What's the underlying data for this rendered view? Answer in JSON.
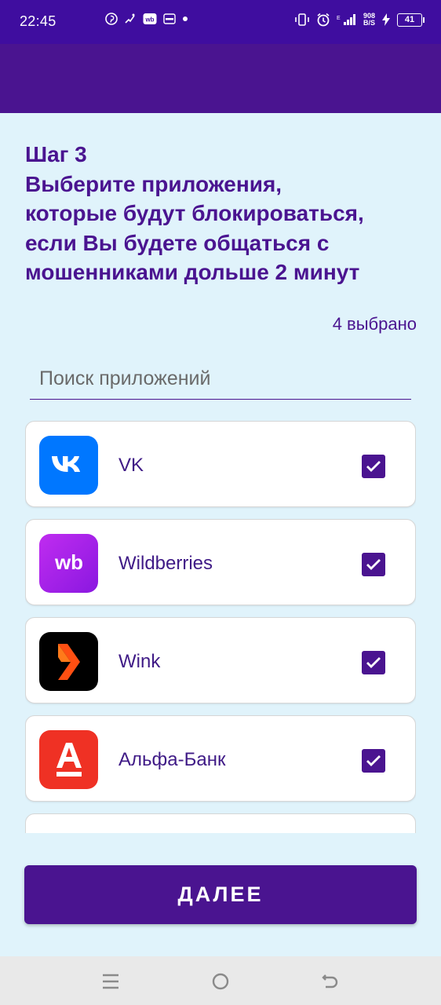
{
  "status_bar": {
    "time": "22:45",
    "net_speed_value": "908",
    "net_speed_unit": "B/S",
    "battery": "41"
  },
  "step": {
    "title_line1": "Шаг 3",
    "title_line2": "Выберите приложения,",
    "title_line3": "которые будут блокироваться,",
    "title_line4": "если Вы будете общаться с",
    "title_line5": "мошенниками дольше 2 минут"
  },
  "selected_count": "4 выбрано",
  "search": {
    "placeholder": "Поиск приложений",
    "value": ""
  },
  "apps": [
    {
      "name": "VK",
      "icon": "vk-icon",
      "checked": true,
      "color": "#0077ff"
    },
    {
      "name": "Wildberries",
      "icon": "wildberries-icon",
      "checked": true,
      "color": "#b01ee8"
    },
    {
      "name": "Wink",
      "icon": "wink-icon",
      "checked": true,
      "color": "#000000"
    },
    {
      "name": "Альфа-Банк",
      "icon": "alfa-bank-icon",
      "checked": true,
      "color": "#ef3124"
    }
  ],
  "next_button": {
    "label": "ДАЛЕЕ"
  },
  "colors": {
    "accent": "#4a1490",
    "status_bar": "#3f0d9f",
    "background": "#e0f3fb"
  }
}
